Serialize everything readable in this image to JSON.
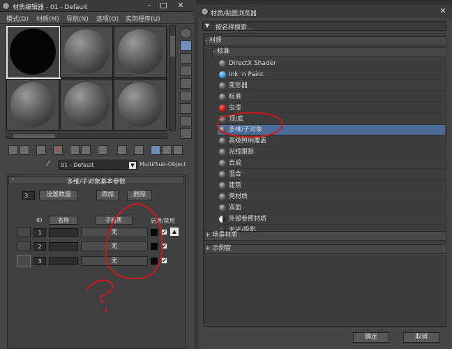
{
  "left_window": {
    "title": "材质编辑器 - 01 - Default",
    "menu": [
      "模式(D)",
      "材质(M)",
      "导航(N)",
      "选项(O)",
      "实用程序(U)"
    ],
    "material_selector": {
      "value": "01 - Default",
      "type": "Multi/Sub-Object"
    },
    "rollout": {
      "title": "多维/子对象基本参数",
      "count_value": "3",
      "set_count_label": "设置数量",
      "add_label": "添加",
      "delete_label": "删除",
      "headers": {
        "id": "ID",
        "name": "名称",
        "submaterial": "子材质",
        "enable": "启用/禁用"
      },
      "rows": [
        {
          "id": "1",
          "submaterial": "无"
        },
        {
          "id": "2",
          "submaterial": "无"
        },
        {
          "id": "3",
          "submaterial": "无"
        }
      ],
      "check_mark": "✔"
    },
    "annotation": "?"
  },
  "right_window": {
    "title": "材质/贴图浏览器",
    "search_placeholder": "按名称搜索...",
    "sections": {
      "materials": "- 材质",
      "standard": "- 标准",
      "scene_materials": "+ 场景材质",
      "sample_slots": "+ 示例窗"
    },
    "items": [
      {
        "label": "DirectX Shader",
        "icon": "sphere-gray"
      },
      {
        "label": "Ink 'n Paint",
        "icon": "sphere-blue"
      },
      {
        "label": "变形器",
        "icon": "sphere-gray"
      },
      {
        "label": "标准",
        "icon": "sphere-gray"
      },
      {
        "label": "虫漆",
        "icon": "sphere-red"
      },
      {
        "label": "顶/底",
        "icon": "sphere-gray"
      },
      {
        "label": "多维/子对象",
        "icon": "sphere-gray",
        "selected": true
      },
      {
        "label": "高级照明覆盖",
        "icon": "sphere-gray"
      },
      {
        "label": "光线跟踪",
        "icon": "sphere-gray"
      },
      {
        "label": "合成",
        "icon": "sphere-gray"
      },
      {
        "label": "混合",
        "icon": "sphere-gray"
      },
      {
        "label": "建筑",
        "icon": "sphere-gray"
      },
      {
        "label": "壳材质",
        "icon": "sphere-gray"
      },
      {
        "label": "双面",
        "icon": "sphere-gray"
      },
      {
        "label": "外部参照材质",
        "icon": "sphere-half"
      },
      {
        "label": "无光/投影",
        "icon": "sphere-dark"
      }
    ],
    "ok_label": "确定",
    "cancel_label": "取消"
  },
  "colors": {
    "selection": "#4a6a98",
    "annotation": "#d01818"
  }
}
